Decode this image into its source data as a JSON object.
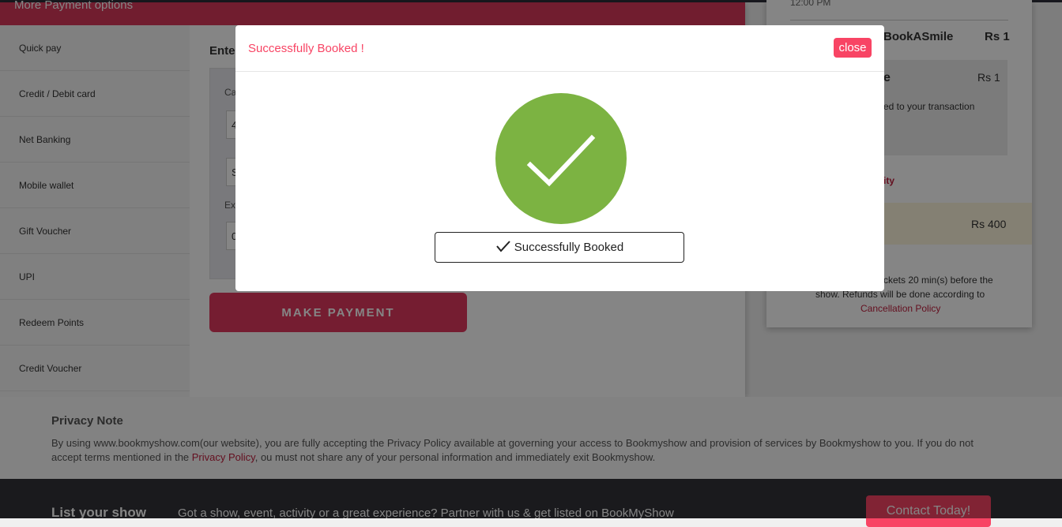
{
  "payment_panel": {
    "header_title": "More Payment options",
    "options": [
      "Quick pay",
      "Credit / Debit card",
      "Net Banking",
      "Mobile wallet",
      "Gift Voucher",
      "UPI",
      "Redeem Points",
      "Credit Voucher"
    ],
    "enter_label": "Ente",
    "card_number_label": "Ca",
    "card_number_value": "4",
    "name_value": "S",
    "expiry_label": "Ex",
    "expiry_value": "0",
    "make_payment_label": "MAKE PAYMENT"
  },
  "summary": {
    "time": "12:00 PM",
    "name": "BookASmile",
    "price1": "Rs 1",
    "partial_title": "e",
    "price2": "Rs 1",
    "transaction_text": "ed to your transaction",
    "partial_link": "ity",
    "total": "Rs 400",
    "note_line1": "tickets 20 min(s) before the",
    "note_line2": "show. Refunds will be done according to",
    "cancellation_policy": "Cancellation Policy"
  },
  "privacy": {
    "title": "Privacy Note",
    "text_before": "By using www.bookmyshow.com(our website), you are fully accepting the Privacy Policy available at governing your access to Bookmyshow and provision of services by Bookmyshow to you. If you do not accept terms mentioned in the ",
    "link": "Privacy Policy",
    "text_after": ", ou must not share any of your personal information and immediately exit Bookmyshow."
  },
  "footer": {
    "title": "List your show",
    "text": "Got a show, event, activity or a great experience? Partner with us & get listed on BookMyShow",
    "button": "Contact Today!"
  },
  "modal": {
    "title": "Successfully Booked !",
    "close_label": "close",
    "status_text": "Successfully Booked",
    "success_icon": "check-circle-icon"
  },
  "colors": {
    "brand": "#f84464",
    "success": "#7cb342"
  }
}
